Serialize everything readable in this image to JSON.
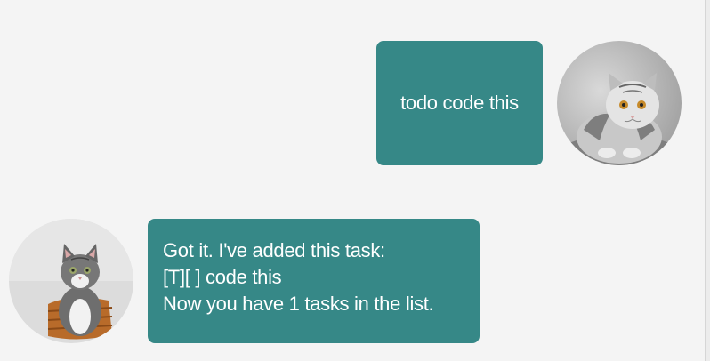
{
  "conversation": {
    "user_message": {
      "text": "todo code this",
      "avatar_icon": "gray-tabby-cat-avatar"
    },
    "bot_message": {
      "lines": [
        "Got it. I've added this task:",
        "[T][ ] code this",
        "Now you have 1 tasks in the list."
      ],
      "avatar_icon": "tabby-cat-in-basket-avatar"
    }
  },
  "colors": {
    "bubble": "#368887",
    "bubble_text": "#ffffff",
    "background": "#f4f4f4"
  }
}
